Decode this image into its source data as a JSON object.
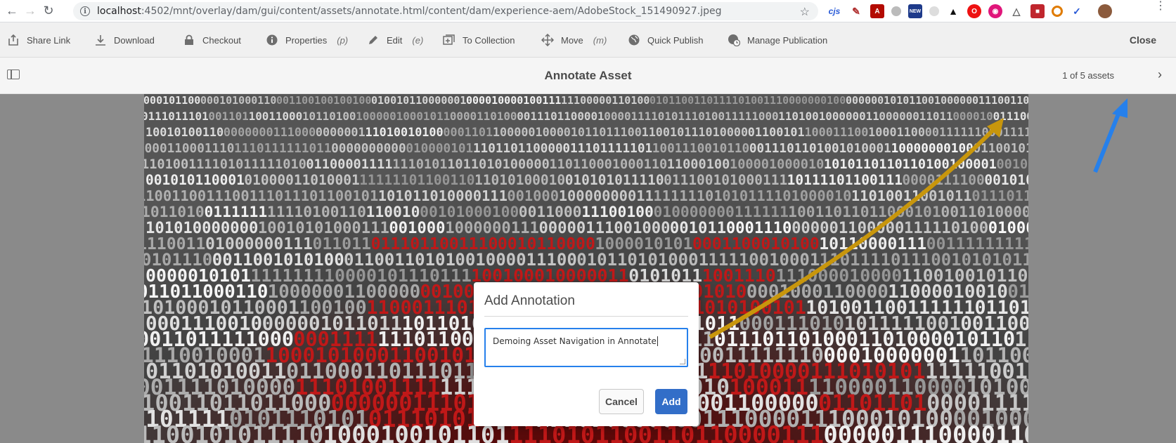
{
  "browser": {
    "url_host": "localhost",
    "url_rest": ":4502/mnt/overlay/dam/gui/content/assets/annotate.html/content/dam/experience-aem/AdobeStock_151490927.jpeg",
    "extensions": [
      "cjs",
      "",
      "",
      "",
      "NEW",
      "",
      "",
      "",
      "",
      "",
      "",
      "",
      "",
      "",
      ""
    ]
  },
  "actions": [
    {
      "label": "Share Link",
      "shortcut": "",
      "icon": "share-icon"
    },
    {
      "label": "Download",
      "shortcut": "",
      "icon": "download-icon"
    },
    {
      "label": "Checkout",
      "shortcut": "",
      "icon": "lock-icon"
    },
    {
      "label": "Properties",
      "shortcut": "(p)",
      "icon": "info-icon"
    },
    {
      "label": "Edit",
      "shortcut": "(e)",
      "icon": "pencil-icon"
    },
    {
      "label": "To Collection",
      "shortcut": "",
      "icon": "collection-icon"
    },
    {
      "label": "Move",
      "shortcut": "(m)",
      "icon": "move-icon"
    },
    {
      "label": "Quick Publish",
      "shortcut": "",
      "icon": "globe-icon"
    },
    {
      "label": "Manage Publication",
      "shortcut": "",
      "icon": "globe-clock-icon"
    }
  ],
  "close_label": "Close",
  "title_bar": {
    "title": "Annotate Asset",
    "asset_count": "1 of 5 assets"
  },
  "dialog": {
    "title": "Add Annotation",
    "textarea_value": "Demoing Asset Navigation in Annotate",
    "cancel_label": "Cancel",
    "add_label": "Add"
  },
  "colors": {
    "accent": "#326ec8",
    "focus": "#2680eb",
    "annotation_arrow_gold": "#c8960c",
    "annotation_arrow_blue": "#2680eb"
  }
}
